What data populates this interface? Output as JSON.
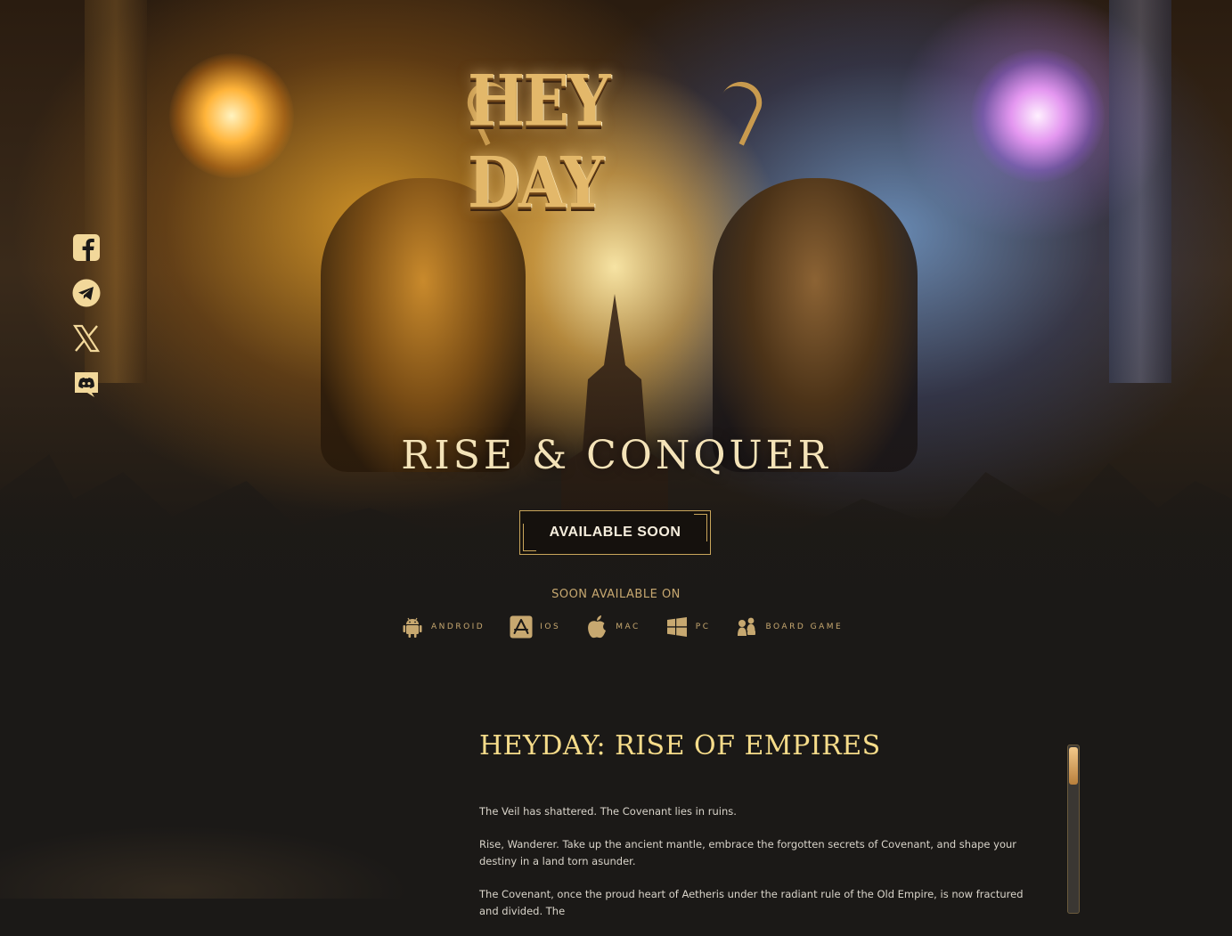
{
  "logo": {
    "text": "HEY DAY"
  },
  "social": {
    "items": [
      {
        "name": "facebook"
      },
      {
        "name": "telegram"
      },
      {
        "name": "x"
      },
      {
        "name": "discord"
      }
    ]
  },
  "hero": {
    "tagline": "RISE & CONQUER",
    "cta_label": "AVAILABLE SOON",
    "platforms_label": "SOON AVAILABLE ON"
  },
  "platforms": [
    {
      "label": "ANDROID",
      "icon": "android-icon"
    },
    {
      "label": "IOS",
      "icon": "app-store-icon"
    },
    {
      "label": "MAC",
      "icon": "apple-icon"
    },
    {
      "label": "PC",
      "icon": "windows-icon"
    },
    {
      "label": "BOARD GAME",
      "icon": "board-game-icon"
    }
  ],
  "about": {
    "title": "HEYDAY: RISE OF EMPIRES",
    "paragraphs": [
      "The Veil has shattered. The Covenant lies in ruins.",
      "Rise, Wanderer. Take up the ancient mantle, embrace the forgotten secrets of Covenant, and shape your destiny in a land torn asunder.",
      "The Covenant, once the proud heart of Aetheris under the radiant rule of the Old Empire, is now fractured and divided. The"
    ]
  },
  "colors": {
    "background": "#1b1917",
    "gold": "#c9a65b",
    "title_gold": "#f6dc8a",
    "icon_gold": "#f2d89a",
    "label_gold": "#c7a870"
  }
}
